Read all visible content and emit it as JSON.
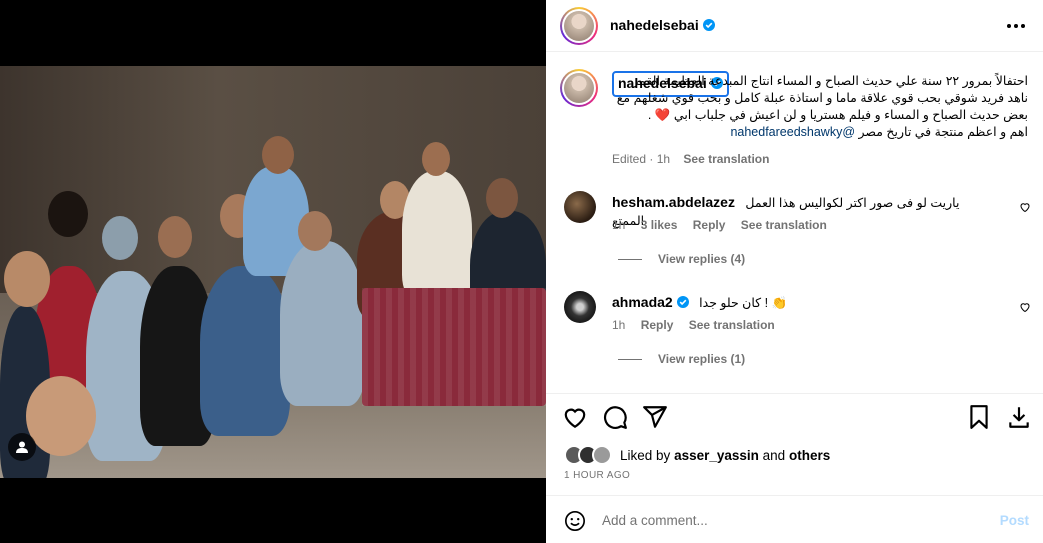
{
  "post": {
    "username": "nahedelsebai",
    "verified": true
  },
  "caption": {
    "username": "nahedelsebai",
    "text": "احتفالاً بمرور ٢٢ سنة علي حديث الصباح و المساء انتاج المبدعة العظيمة القمر ناهد فريد شوقي بحب قوي علاقة ماما و استاذة عبلة كامل و بحب قوي شغلهم مع بعض حديث الصباح و المساء و فيلم هستريا و لن اعيش في جلباب ابي ❤️ .",
    "text_line4_prefix": "اهم و اعظم منتجة في تاريخ مصر",
    "mention": "@nahedfareedshawky",
    "edited": "Edited",
    "time": "1h",
    "see_translation": "See translation"
  },
  "comments": [
    {
      "username": "hesham.abdelazez",
      "text": "ياريت لو فى صور اكتر لكواليس هذا العمل الممتع",
      "time": "1h",
      "likes": "3 likes",
      "reply": "Reply",
      "see_translation": "See translation",
      "view_replies": "View replies (4)"
    },
    {
      "username": "ahmada2",
      "verified": true,
      "text": "كان حلو جدا ! 👏",
      "time": "1h",
      "reply": "Reply",
      "see_translation": "See translation",
      "view_replies": "View replies (1)"
    }
  ],
  "likes": {
    "prefix": "Liked by",
    "user": "asser_yassin",
    "and": "and",
    "others": "others"
  },
  "timestamp": "1 HOUR AGO",
  "add_comment": {
    "placeholder": "Add a comment...",
    "post": "Post"
  },
  "icons": [
    "more-icon",
    "heart-icon",
    "comment-icon",
    "share-icon",
    "bookmark-icon",
    "download-icon",
    "emoji-icon",
    "user-tag-icon",
    "verified-icon"
  ],
  "colors": {
    "verified": "#0095f6",
    "link": "#00376b",
    "muted": "#737373",
    "post_disabled": "#b3dbff",
    "caption_highlight": "#1a73e8"
  }
}
